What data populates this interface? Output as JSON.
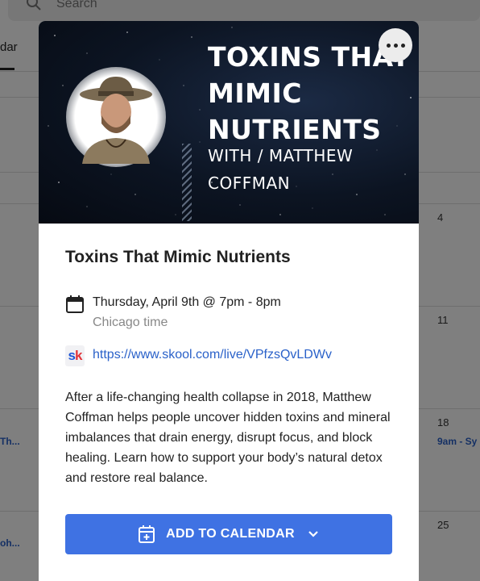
{
  "background": {
    "search_placeholder": "Search",
    "tab_label": "dar",
    "day_numbers": [
      "4",
      "11",
      "18",
      "25"
    ],
    "right_event": "9am - Sy",
    "left_events": [
      "Th...",
      "oh..."
    ]
  },
  "modal": {
    "more_label": "More options",
    "hero": {
      "title": "TOXINS THAT\nMIMIC\nNUTRIENTS",
      "byline": "WITH / MATTHEW\nCOFFMAN"
    },
    "title": "Toxins That Mimic Nutrients",
    "date": "Thursday, April 9th @ 7pm - 8pm",
    "timezone": "Chicago time",
    "link_icon_text": "sk",
    "link": "https://www.skool.com/live/VPfzsQvLDWv",
    "description": "After a life-changing health collapse in 2018, Matthew Coffman helps people uncover hidden toxins and mineral imbalances that drain energy, disrupt focus, and block healing. Learn how to support your body’s natural detox and restore real balance.",
    "add_button": "ADD TO CALENDAR"
  },
  "colors": {
    "accent": "#3f72e3",
    "link": "#2a61c9",
    "scrim": "rgba(0,0,0,0.5)"
  }
}
